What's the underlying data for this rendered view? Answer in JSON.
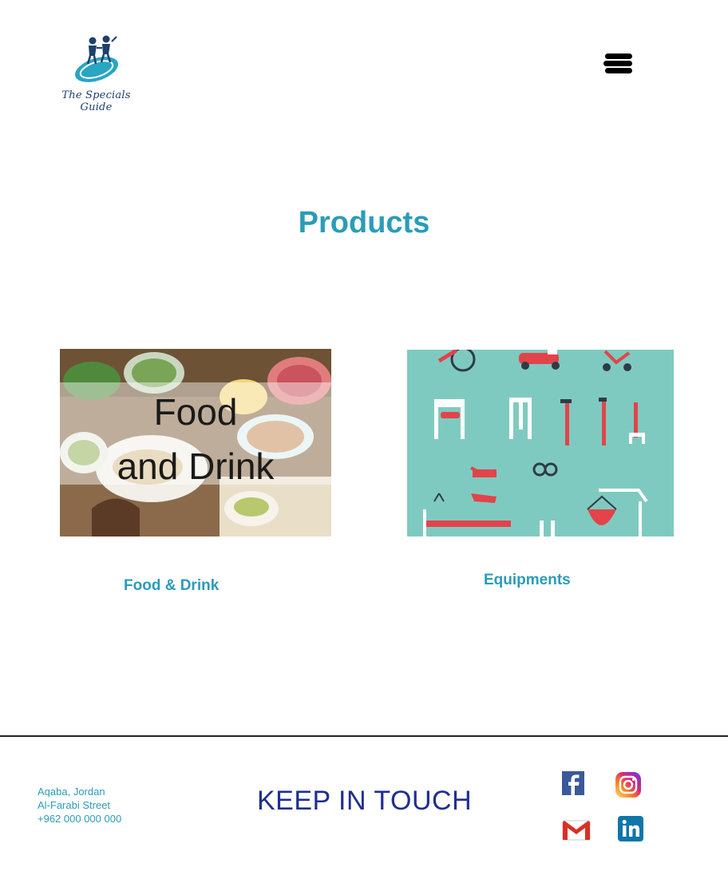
{
  "header": {
    "logo_text": "The Specials Guide",
    "menu_icon": "hamburger-menu-icon"
  },
  "main": {
    "title": "Products",
    "cards": [
      {
        "image_text_line1": "Food",
        "image_text_line2": "and Drink",
        "label": "Food & Drink"
      },
      {
        "label": "Equipments"
      }
    ]
  },
  "footer": {
    "address_line1": "Aqaba, Jordan",
    "address_line2": "Al-Farabi Street",
    "phone": "+962 000 000 000",
    "keep_in_touch": "KEEP IN TOUCH",
    "social_icons": [
      "facebook-icon",
      "instagram-icon",
      "gmail-icon",
      "linkedin-icon"
    ]
  },
  "colors": {
    "accent": "#2b9cb7",
    "footer_heading": "#1e2f8e",
    "equipment_bg": "#7fcac0",
    "equipment_red": "#e2444a"
  }
}
